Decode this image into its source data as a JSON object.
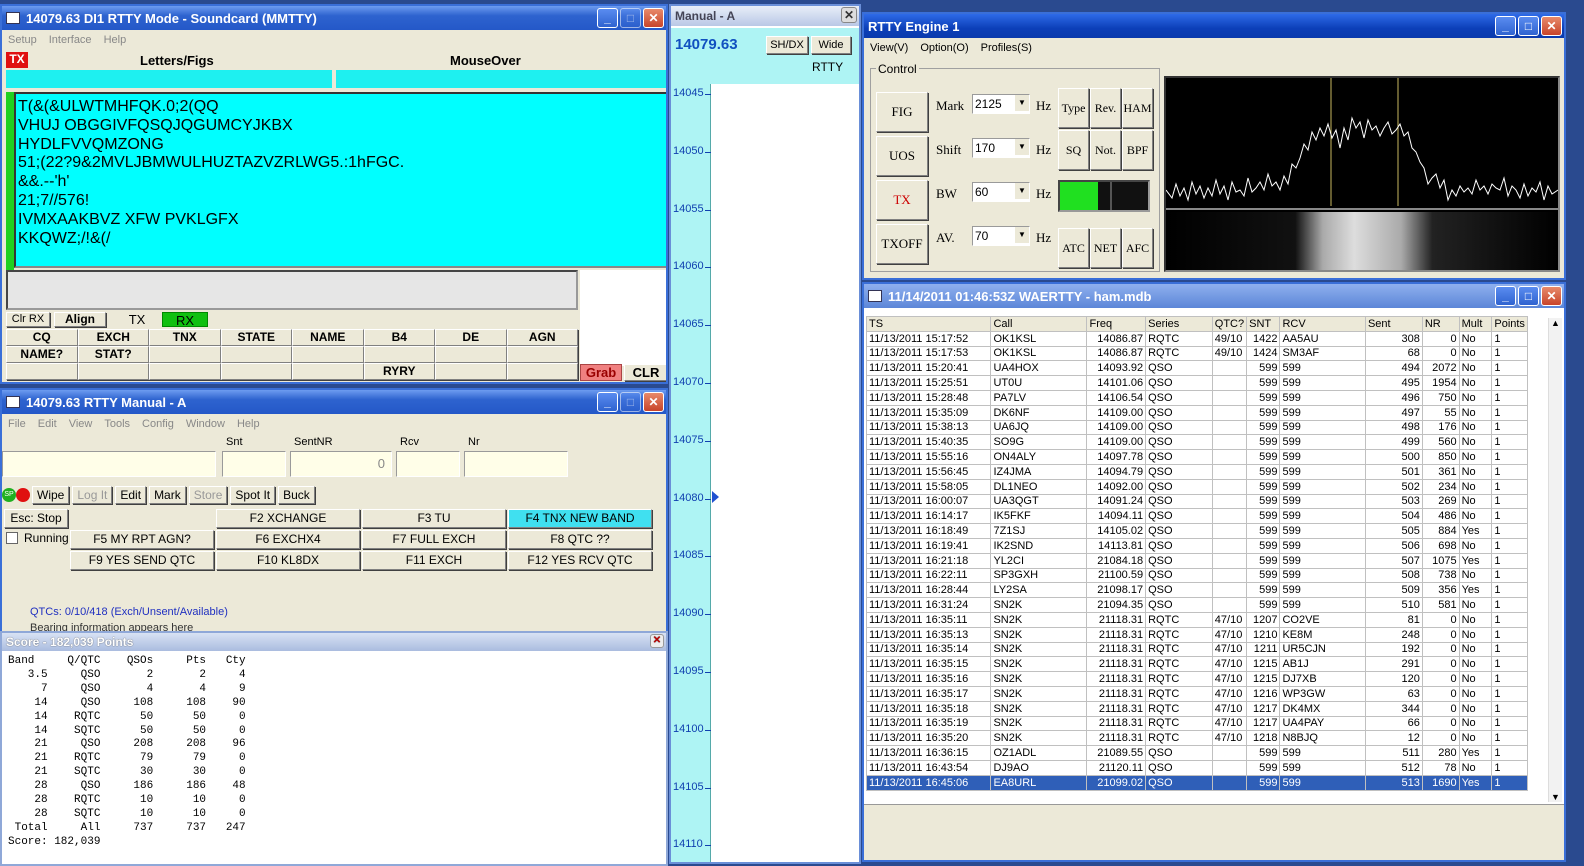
{
  "mmtty": {
    "title": "14079.63  DI1 RTTY Mode - Soundcard (MMTTY)",
    "menu": [
      "Setup",
      "Interface",
      "Help"
    ],
    "tx_badge": "TX",
    "letters_figs": "Letters/Figs",
    "mouseover": "MouseOver",
    "rx_lines": [
      "T(&(&ULWTMHFQK.0;2(QQ",
      "VHUJ OBGGIVFQSQJQGUMCYJKBX",
      "HYDLFVVQMZONG",
      "51;(22?9&2MVLJBMWULHUZTAZVZRLWG5.:1hFGC.",
      "&&.--'h'",
      "21;7//576!",
      "IVMXAAKBVZ XFW PVKLGFX",
      "KKQWZ;/!&(/"
    ],
    "clr_rx": "Clr RX",
    "align": "Align",
    "tx": "TX",
    "rx": "RX",
    "macros": [
      [
        "CQ",
        "EXCH",
        "TNX",
        "STATE",
        "NAME",
        "B4",
        "DE",
        "AGN"
      ],
      [
        "NAME?",
        "STAT?",
        "",
        "",
        "",
        "",
        "",
        ""
      ],
      [
        "",
        "",
        "",
        "",
        "",
        "RYRY",
        "",
        ""
      ]
    ],
    "grab": "Grab",
    "clr": "CLR"
  },
  "manual_a": {
    "title": "Manual - A",
    "freq": "14079.63",
    "shdx": "SH/DX",
    "wide": "Wide",
    "mode": "RTTY",
    "scale": [
      "14045",
      "14050",
      "14055",
      "14060",
      "14065",
      "14070",
      "14075",
      "14080",
      "14085",
      "14090",
      "14095",
      "14100",
      "14105",
      "14110"
    ]
  },
  "manual": {
    "title": "14079.63  RTTY Manual - A",
    "menu": [
      "File",
      "Edit",
      "View",
      "Tools",
      "Config",
      "Window",
      "Help"
    ],
    "labels": {
      "snt": "Snt",
      "sentnr": "SentNR",
      "rcv": "Rcv",
      "nr": "Nr"
    },
    "sentnr_value": "0",
    "sp": "SP",
    "buttons": [
      "Wipe",
      "Log It",
      "Edit",
      "Mark",
      "Store",
      "Spot It",
      "Buck"
    ],
    "esc": "Esc: Stop",
    "running": "Running",
    "fkeys": [
      [
        "F2 XCHANGE",
        "F3 TU",
        "F4 TNX NEW BAND"
      ],
      [
        "F5 MY RPT AGN?",
        "F6 EXCHX4",
        "F7 FULL EXCH",
        "F8 QTC ??"
      ],
      [
        "F9 YES SEND QTC",
        "F10 KL8DX",
        "F11 EXCH",
        "F12 YES RCV QTC"
      ]
    ],
    "qtcs": "QTCs: 0/10/418 (Exch/Unsent/Available)",
    "beam": "Bearing information appears here"
  },
  "score": {
    "title": "Score - 182,039 Points",
    "header": [
      "Band",
      "Q/QTC",
      "QSOs",
      "Pts",
      "Cty"
    ],
    "rows": [
      [
        "3.5",
        "QSO",
        "2",
        "2",
        "4"
      ],
      [
        "7",
        "QSO",
        "4",
        "4",
        "9"
      ],
      [
        "14",
        "QSO",
        "108",
        "108",
        "90"
      ],
      [
        "14",
        "RQTC",
        "50",
        "50",
        "0"
      ],
      [
        "14",
        "SQTC",
        "50",
        "50",
        "0"
      ],
      [
        "21",
        "QSO",
        "208",
        "208",
        "96"
      ],
      [
        "21",
        "RQTC",
        "79",
        "79",
        "0"
      ],
      [
        "21",
        "SQTC",
        "30",
        "30",
        "0"
      ],
      [
        "28",
        "QSO",
        "186",
        "186",
        "48"
      ],
      [
        "28",
        "RQTC",
        "10",
        "10",
        "0"
      ],
      [
        "28",
        "SQTC",
        "10",
        "10",
        "0"
      ],
      [
        "Total",
        "All",
        "737",
        "737",
        "247"
      ]
    ],
    "total": "Score: 182,039"
  },
  "engine": {
    "title": "RTTY Engine 1",
    "menu": [
      "View(V)",
      "Option(O)",
      "Profiles(S)"
    ],
    "control": "Control",
    "side": [
      "FIG",
      "UOS",
      "TX",
      "TXOFF"
    ],
    "params": [
      {
        "label": "Mark",
        "value": "2125"
      },
      {
        "label": "Shift",
        "value": "170"
      },
      {
        "label": "BW",
        "value": "60"
      },
      {
        "label": "AV.",
        "value": "70"
      }
    ],
    "hz": "Hz",
    "rbtns": [
      [
        "Type",
        "Rev.",
        "HAM"
      ],
      [
        "SQ",
        "Not.",
        "BPF"
      ],
      [
        "ATC",
        "NET",
        "AFC"
      ]
    ]
  },
  "log": {
    "title": "11/14/2011 01:46:53Z  WAERTTY - ham.mdb",
    "cols": [
      "TS",
      "Call",
      "Freq",
      "Series",
      "QTC?",
      "SNT",
      "RCV",
      "Sent",
      "NR",
      "Mult",
      "Points"
    ],
    "rows": [
      [
        "11/13/2011 15:17:52",
        "OK1KSL",
        "14086.87",
        "RQTC",
        "49/10",
        "1422",
        "AA5AU",
        "308",
        "0",
        "No",
        "1"
      ],
      [
        "11/13/2011 15:17:53",
        "OK1KSL",
        "14086.87",
        "RQTC",
        "49/10",
        "1424",
        "SM3AF",
        "68",
        "0",
        "No",
        "1"
      ],
      [
        "11/13/2011 15:20:41",
        "UA4HOX",
        "14093.92",
        "QSO",
        "",
        "599",
        "599",
        "494",
        "2072",
        "No",
        "1"
      ],
      [
        "11/13/2011 15:25:51",
        "UT0U",
        "14101.06",
        "QSO",
        "",
        "599",
        "599",
        "495",
        "1954",
        "No",
        "1"
      ],
      [
        "11/13/2011 15:28:48",
        "PA7LV",
        "14106.54",
        "QSO",
        "",
        "599",
        "599",
        "496",
        "750",
        "No",
        "1"
      ],
      [
        "11/13/2011 15:35:09",
        "DK6NF",
        "14109.00",
        "QSO",
        "",
        "599",
        "599",
        "497",
        "55",
        "No",
        "1"
      ],
      [
        "11/13/2011 15:38:13",
        "UA6JQ",
        "14109.00",
        "QSO",
        "",
        "599",
        "599",
        "498",
        "176",
        "No",
        "1"
      ],
      [
        "11/13/2011 15:40:35",
        "SO9G",
        "14109.00",
        "QSO",
        "",
        "599",
        "599",
        "499",
        "560",
        "No",
        "1"
      ],
      [
        "11/13/2011 15:55:16",
        "ON4ALY",
        "14097.78",
        "QSO",
        "",
        "599",
        "599",
        "500",
        "850",
        "No",
        "1"
      ],
      [
        "11/13/2011 15:56:45",
        "IZ4JMA",
        "14094.79",
        "QSO",
        "",
        "599",
        "599",
        "501",
        "361",
        "No",
        "1"
      ],
      [
        "11/13/2011 15:58:05",
        "DL1NEO",
        "14092.00",
        "QSO",
        "",
        "599",
        "599",
        "502",
        "234",
        "No",
        "1"
      ],
      [
        "11/13/2011 16:00:07",
        "UA3QGT",
        "14091.24",
        "QSO",
        "",
        "599",
        "599",
        "503",
        "269",
        "No",
        "1"
      ],
      [
        "11/13/2011 16:14:17",
        "IK5FKF",
        "14094.11",
        "QSO",
        "",
        "599",
        "599",
        "504",
        "486",
        "No",
        "1"
      ],
      [
        "11/13/2011 16:18:49",
        "7Z1SJ",
        "14105.02",
        "QSO",
        "",
        "599",
        "599",
        "505",
        "884",
        "Yes",
        "1"
      ],
      [
        "11/13/2011 16:19:41",
        "IK2SND",
        "14113.81",
        "QSO",
        "",
        "599",
        "599",
        "506",
        "698",
        "No",
        "1"
      ],
      [
        "11/13/2011 16:21:18",
        "YL2CI",
        "21084.18",
        "QSO",
        "",
        "599",
        "599",
        "507",
        "1075",
        "Yes",
        "1"
      ],
      [
        "11/13/2011 16:22:11",
        "SP3GXH",
        "21100.59",
        "QSO",
        "",
        "599",
        "599",
        "508",
        "738",
        "No",
        "1"
      ],
      [
        "11/13/2011 16:28:44",
        "LY2SA",
        "21098.17",
        "QSO",
        "",
        "599",
        "599",
        "509",
        "356",
        "Yes",
        "1"
      ],
      [
        "11/13/2011 16:31:24",
        "SN2K",
        "21094.35",
        "QSO",
        "",
        "599",
        "599",
        "510",
        "581",
        "No",
        "1"
      ],
      [
        "11/13/2011 16:35:11",
        "SN2K",
        "21118.31",
        "RQTC",
        "47/10",
        "1207",
        "CO2VE",
        "81",
        "0",
        "No",
        "1"
      ],
      [
        "11/13/2011 16:35:13",
        "SN2K",
        "21118.31",
        "RQTC",
        "47/10",
        "1210",
        "KE8M",
        "248",
        "0",
        "No",
        "1"
      ],
      [
        "11/13/2011 16:35:14",
        "SN2K",
        "21118.31",
        "RQTC",
        "47/10",
        "1211",
        "UR5CJN",
        "192",
        "0",
        "No",
        "1"
      ],
      [
        "11/13/2011 16:35:15",
        "SN2K",
        "21118.31",
        "RQTC",
        "47/10",
        "1215",
        "AB1J",
        "291",
        "0",
        "No",
        "1"
      ],
      [
        "11/13/2011 16:35:16",
        "SN2K",
        "21118.31",
        "RQTC",
        "47/10",
        "1215",
        "DJ7XB",
        "120",
        "0",
        "No",
        "1"
      ],
      [
        "11/13/2011 16:35:17",
        "SN2K",
        "21118.31",
        "RQTC",
        "47/10",
        "1216",
        "WP3GW",
        "63",
        "0",
        "No",
        "1"
      ],
      [
        "11/13/2011 16:35:18",
        "SN2K",
        "21118.31",
        "RQTC",
        "47/10",
        "1217",
        "DK4MX",
        "344",
        "0",
        "No",
        "1"
      ],
      [
        "11/13/2011 16:35:19",
        "SN2K",
        "21118.31",
        "RQTC",
        "47/10",
        "1217",
        "UA4PAY",
        "66",
        "0",
        "No",
        "1"
      ],
      [
        "11/13/2011 16:35:20",
        "SN2K",
        "21118.31",
        "RQTC",
        "47/10",
        "1218",
        "N8BJQ",
        "12",
        "0",
        "No",
        "1"
      ],
      [
        "11/13/2011 16:36:15",
        "OZ1ADL",
        "21089.55",
        "QSO",
        "",
        "599",
        "599",
        "511",
        "280",
        "Yes",
        "1"
      ],
      [
        "11/13/2011 16:43:54",
        "DJ9AO",
        "21120.11",
        "QSO",
        "",
        "599",
        "599",
        "512",
        "78",
        "No",
        "1"
      ],
      [
        "11/13/2011 16:45:06",
        "EA8URL",
        "21099.02",
        "QSO",
        "",
        "599",
        "599",
        "513",
        "1690",
        "Yes",
        "1"
      ]
    ]
  }
}
